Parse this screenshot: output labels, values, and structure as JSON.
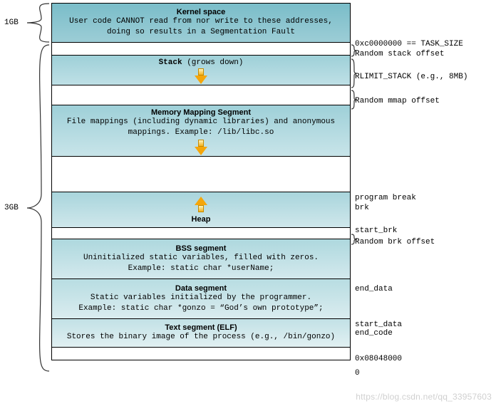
{
  "left": {
    "size_1gb": "1GB",
    "size_3gb": "3GB"
  },
  "segments": {
    "kernel": {
      "title": "Kernel space",
      "desc": "User code CANNOT read from nor write to these addresses, doing so results in a Segmentation Fault"
    },
    "stack": {
      "title": "Stack",
      "subtitle": " (grows down)"
    },
    "mmap": {
      "title": "Memory Mapping Segment",
      "desc": "File mappings (including dynamic libraries) and anonymous mappings. Example: /lib/libc.so"
    },
    "heap": {
      "title": "Heap"
    },
    "bss": {
      "title": "BSS segment",
      "desc1": "Uninitialized static variables, filled with zeros.",
      "desc2": "Example: static char *userName;"
    },
    "data": {
      "title": "Data segment",
      "desc1": "Static variables initialized by the programmer.",
      "desc2": "Example: static char *gonzo = “God’s own prototype”;"
    },
    "text": {
      "title": "Text segment (ELF)",
      "desc": "Stores the binary image of the process (e.g., /bin/gonzo)"
    }
  },
  "right": {
    "task_size": "0xc0000000 == TASK_SIZE",
    "rand_stack": "Random stack offset",
    "rlimit": "RLIMIT_STACK (e.g., 8MB)",
    "rand_mmap": "Random mmap offset",
    "program_break": "program break",
    "brk": "brk",
    "start_brk": "start_brk",
    "rand_brk": "Random brk offset",
    "end_data": "end_data",
    "start_data": "start_data",
    "end_code": "end_code",
    "addr_text": "0x08048000",
    "zero": "0"
  },
  "watermark": "https://blog.csdn.net/qq_33957603"
}
